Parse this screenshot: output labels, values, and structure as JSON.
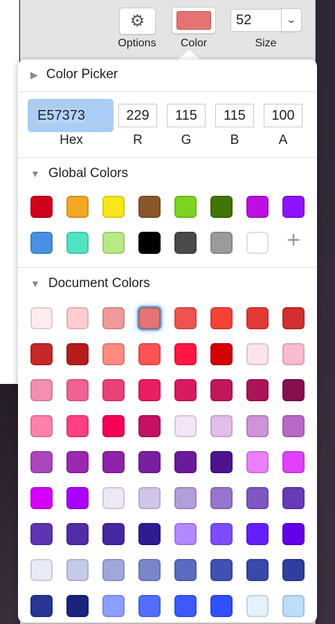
{
  "toolbar": {
    "options_label": "Options",
    "color_label": "Color",
    "size_label": "Size",
    "size_value": "52",
    "current_color": "#E57373"
  },
  "picker": {
    "title": "Color Picker",
    "hex": "E57373",
    "r": "229",
    "g": "115",
    "b": "115",
    "a": "100",
    "hex_label": "Hex",
    "r_label": "R",
    "g_label": "G",
    "b_label": "B",
    "a_label": "A"
  },
  "global": {
    "title": "Global Colors",
    "add_label": "+",
    "colors": [
      "#D0021B",
      "#F5A623",
      "#F8E71C",
      "#8B572A",
      "#7ED321",
      "#417505",
      "#BD10E0",
      "#9013FE",
      "#4A90E2",
      "#50E3C2",
      "#B8E986",
      "#000000",
      "#4A4A4A",
      "#9B9B9B",
      "#FFFFFF"
    ]
  },
  "document": {
    "title": "Document Colors",
    "selected": "#E57373",
    "colors": [
      "#FFEBEE",
      "#FFCDD2",
      "#EF9A9A",
      "#E57373",
      "#EF5350",
      "#F44336",
      "#E53935",
      "#D32F2F",
      "#C62828",
      "#B71C1C",
      "#FF8A80",
      "#FF5252",
      "#FF1744",
      "#D50000",
      "#FCE4EC",
      "#F8BBD0",
      "#F48FB1",
      "#F06292",
      "#EC407A",
      "#E91E63",
      "#D81B60",
      "#C2185B",
      "#AD1457",
      "#880E4F",
      "#FF80AB",
      "#FF4081",
      "#F50057",
      "#C51162",
      "#F3E5F5",
      "#E1BEE7",
      "#CE93D8",
      "#BA68C8",
      "#AB47BC",
      "#9C27B0",
      "#8E24AA",
      "#7B1FA2",
      "#6A1B9A",
      "#4A148C",
      "#EA80FC",
      "#E040FB",
      "#D500F9",
      "#AA00FF",
      "#EDE7F6",
      "#D1C4E9",
      "#B39DDB",
      "#9575CD",
      "#7E57C2",
      "#673AB7",
      "#5E35B1",
      "#512DA8",
      "#4527A0",
      "#311B92",
      "#B388FF",
      "#7C4DFF",
      "#651FFF",
      "#6200EA",
      "#E8EAF6",
      "#C5CAE9",
      "#9FA8DA",
      "#7986CB",
      "#5C6BC0",
      "#3F51B5",
      "#3949AB",
      "#303F9F",
      "#283593",
      "#1A237E",
      "#8C9EFF",
      "#536DFE",
      "#3D5AFE",
      "#304FFE",
      "#E3F2FD",
      "#BBDEFB"
    ]
  }
}
